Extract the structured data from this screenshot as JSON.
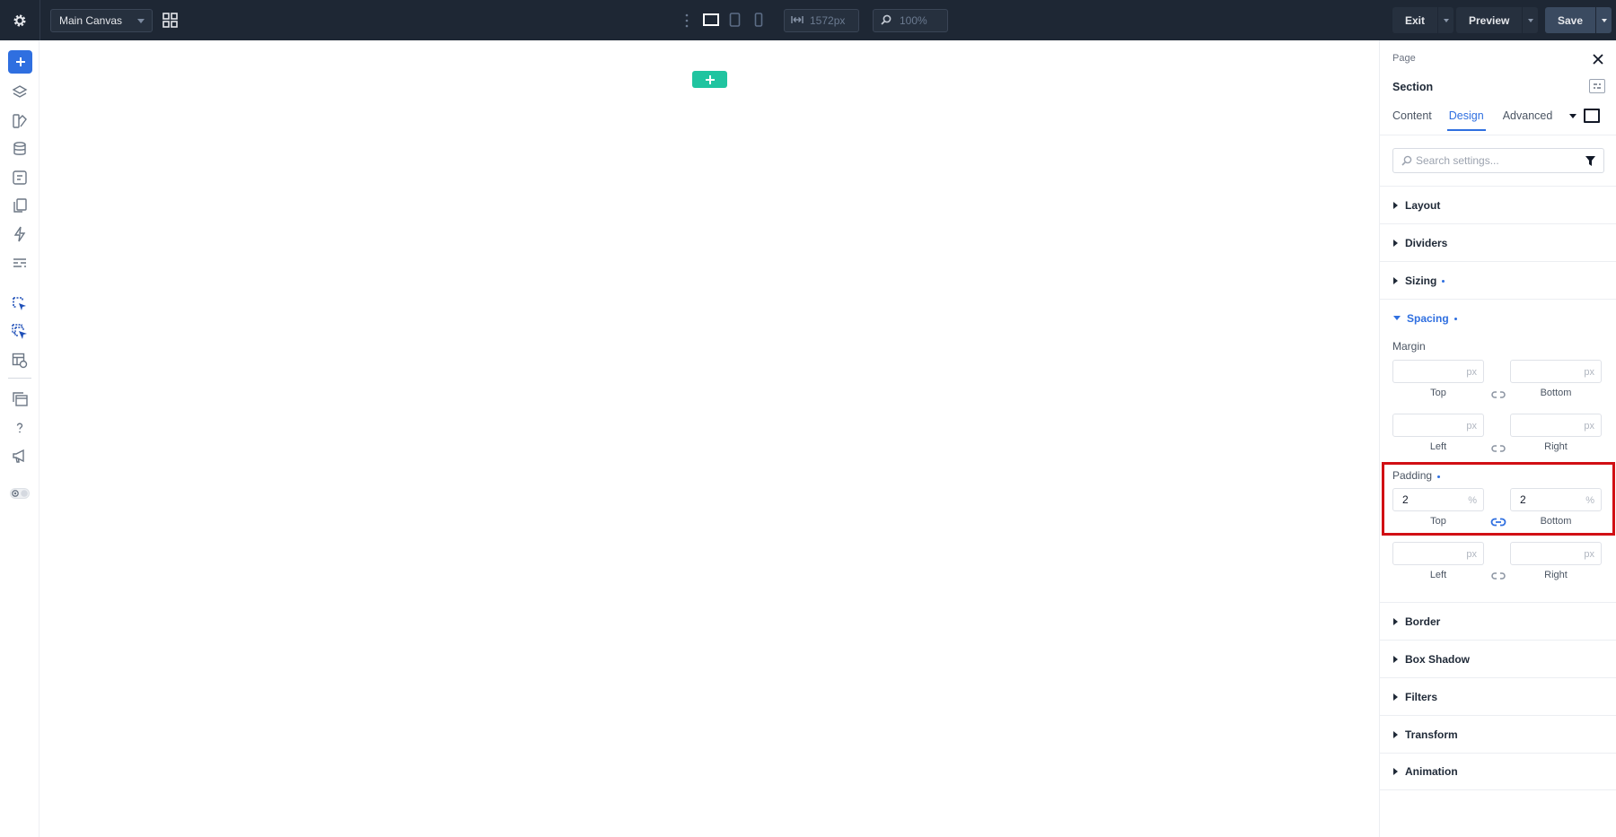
{
  "topbar": {
    "canvas_select": "Main Canvas",
    "width_value": "1572px",
    "zoom_value": "100%",
    "exit_label": "Exit",
    "preview_label": "Preview",
    "save_label": "Save"
  },
  "panel": {
    "breadcrumb": "Page",
    "title": "Section",
    "tabs": [
      "Content",
      "Design",
      "Advanced"
    ],
    "active_tab": "Design",
    "search_placeholder": "Search settings...",
    "sections_top": [
      "Layout",
      "Dividers",
      "Sizing"
    ],
    "spacing": {
      "label": "Spacing",
      "margin": {
        "label": "Margin",
        "top": {
          "value": "",
          "unit": "px",
          "caption": "Top"
        },
        "bottom": {
          "value": "",
          "unit": "px",
          "caption": "Bottom"
        },
        "left": {
          "value": "",
          "unit": "px",
          "caption": "Left"
        },
        "right": {
          "value": "",
          "unit": "px",
          "caption": "Right"
        }
      },
      "padding": {
        "label": "Padding",
        "top": {
          "value": "2",
          "unit": "%",
          "caption": "Top"
        },
        "bottom": {
          "value": "2",
          "unit": "%",
          "caption": "Bottom"
        },
        "left": {
          "value": "",
          "unit": "px",
          "caption": "Left"
        },
        "right": {
          "value": "",
          "unit": "px",
          "caption": "Right"
        }
      }
    },
    "sections_bottom": [
      "Border",
      "Box Shadow",
      "Filters",
      "Transform",
      "Animation"
    ]
  },
  "colors": {
    "accent": "#2f6fe0",
    "topbar": "#1e2734",
    "add_section": "#20c4a0",
    "highlight": "#d10f14"
  }
}
